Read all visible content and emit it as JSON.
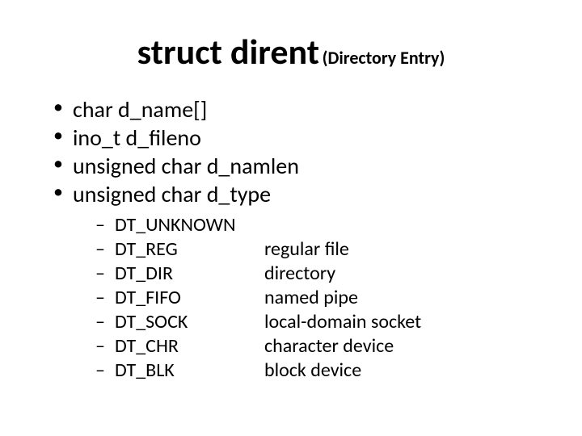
{
  "title": {
    "main": "struct dirent",
    "sub": "(Directory Entry)"
  },
  "fields": {
    "f0": "char d_name[]",
    "f1": "ino_t d_fileno",
    "f2": "unsigned char d_namlen",
    "f3": "unsigned char d_type"
  },
  "types": {
    "t0": {
      "name": "DT_UNKNOWN",
      "desc": ""
    },
    "t1": {
      "name": "DT_REG",
      "desc": "regular file"
    },
    "t2": {
      "name": "DT_DIR",
      "desc": "directory"
    },
    "t3": {
      "name": "DT_FIFO",
      "desc": "named pipe"
    },
    "t4": {
      "name": "DT_SOCK",
      "desc": "local-domain socket"
    },
    "t5": {
      "name": "DT_CHR",
      "desc": "character device"
    },
    "t6": {
      "name": "DT_BLK",
      "desc": "block device"
    }
  }
}
